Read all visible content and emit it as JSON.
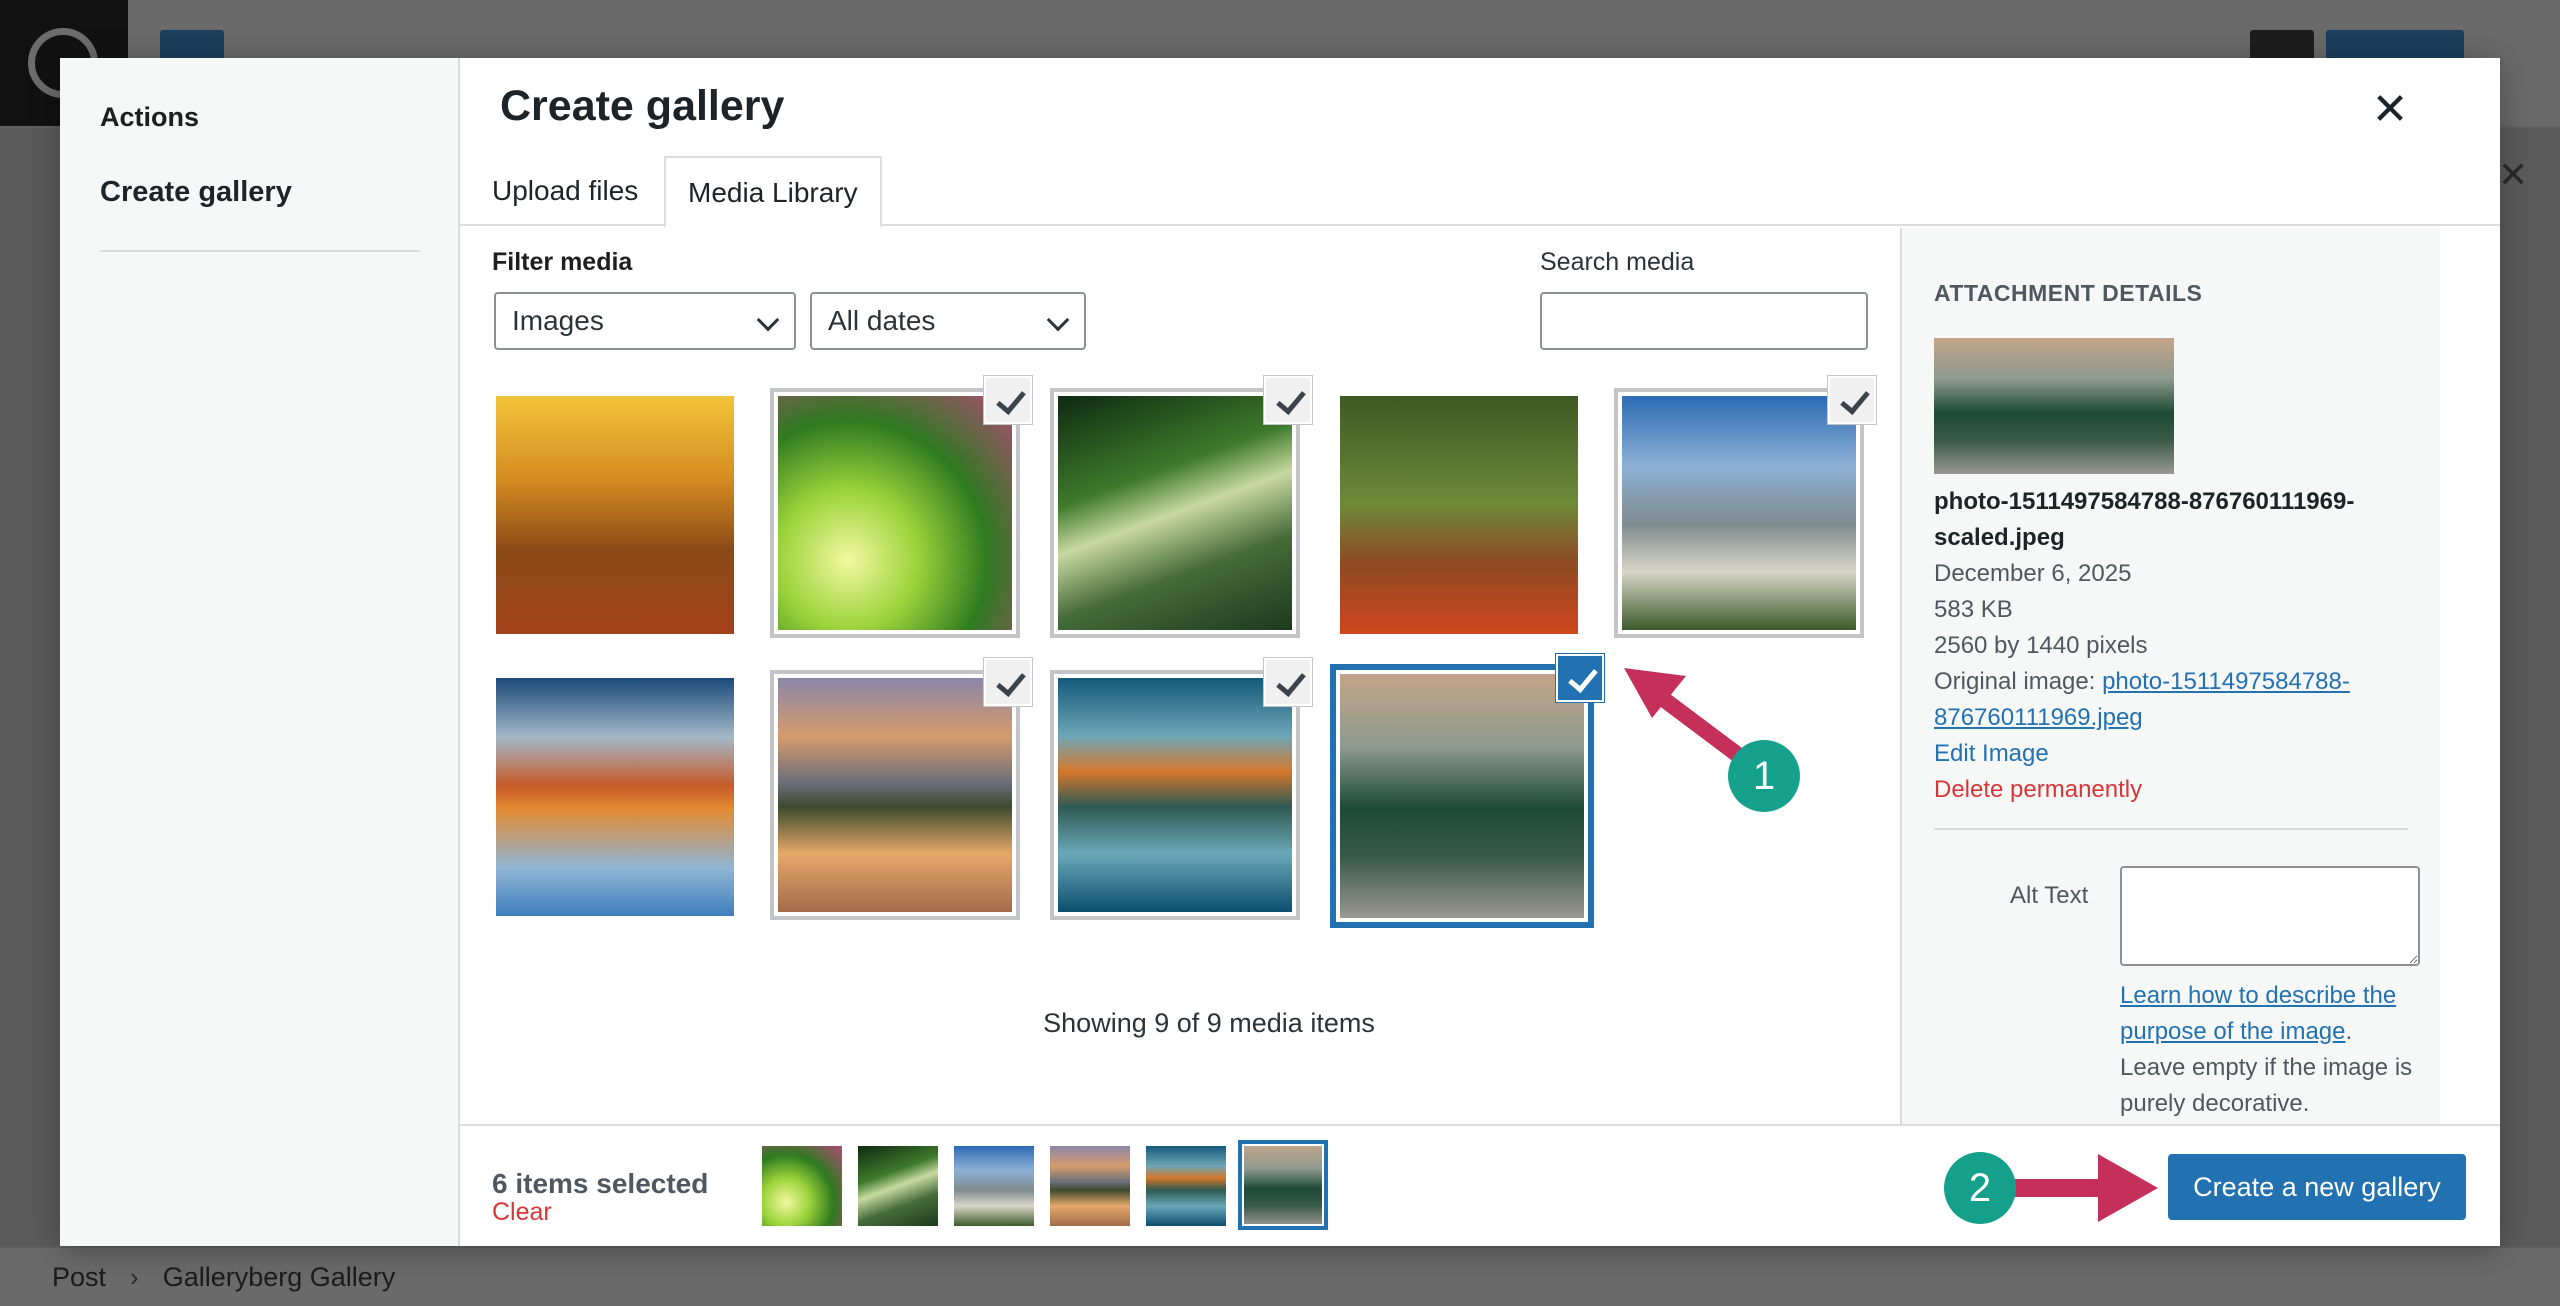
{
  "app": {
    "breadcrumb": [
      "Post",
      "Galleryberg Gallery"
    ]
  },
  "modal": {
    "menu": {
      "heading": "Actions",
      "items": [
        {
          "label": "Create gallery",
          "active": true
        }
      ]
    },
    "title": "Create gallery",
    "tabs": [
      {
        "label": "Upload files",
        "active": false
      },
      {
        "label": "Media Library",
        "active": true
      }
    ],
    "filter": {
      "label": "Filter media",
      "type_select": "Images",
      "date_select": "All dates"
    },
    "search": {
      "label": "Search media",
      "value": "",
      "placeholder": ""
    },
    "media": [
      {
        "name": "autumn-path",
        "selected": false
      },
      {
        "name": "pink-blossoms",
        "selected": true
      },
      {
        "name": "forest-sunbeams",
        "selected": true
      },
      {
        "name": "red-leaf-forest",
        "selected": false
      },
      {
        "name": "mountain-valley",
        "selected": true
      },
      {
        "name": "autumn-lake",
        "selected": false
      },
      {
        "name": "mountain-sunset-reflection",
        "selected": true
      },
      {
        "name": "lake-mountain-reflection",
        "selected": true
      },
      {
        "name": "pine-forest-mountains",
        "selected": true,
        "active": true
      }
    ],
    "showing_text": "Showing 9 of 9 media items",
    "attachment": {
      "heading": "ATTACHMENT DETAILS",
      "filename": "photo-1511497584788-876760111969-scaled.jpeg",
      "date": "December 6, 2025",
      "size": "583 KB",
      "dimensions": "2560 by 1440 pixels",
      "original_label": "Original image:",
      "original_link": "photo-1511497584788-876760111969.jpeg",
      "edit_label": "Edit Image",
      "delete_label": "Delete permanently",
      "alt_label": "Alt Text",
      "alt_value": "",
      "alt_help_link": "Learn how to describe the purpose of the image",
      "alt_help_text": ". Leave empty if the image is purely decorative."
    },
    "toolbar": {
      "selected_count": "6 items selected",
      "clear_label": "Clear",
      "create_button": "Create a new gallery"
    }
  },
  "annotations": [
    {
      "number": "1",
      "color": "#14a08b",
      "arrow_color": "#c4305a"
    },
    {
      "number": "2",
      "color": "#14a08b",
      "arrow_color": "#c4305a"
    }
  ],
  "colors": {
    "accent": "#2271b1",
    "danger": "#d63638",
    "annotation_badge": "#14a08b",
    "annotation_arrow": "#c4305a"
  }
}
